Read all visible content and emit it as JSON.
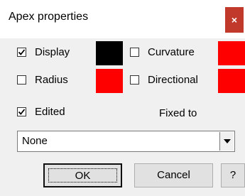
{
  "window": {
    "title": "Apex properties",
    "close_label": "×"
  },
  "options": {
    "display": {
      "label": "Display",
      "checked": true,
      "color": "#000000"
    },
    "curvature": {
      "label": "Curvature",
      "checked": false,
      "color": "#ff0000"
    },
    "radius": {
      "label": "Radius",
      "checked": false,
      "color": "#ff0000"
    },
    "directional": {
      "label": "Directional",
      "checked": false,
      "color": "#ff0000"
    },
    "edited": {
      "label": "Edited",
      "checked": true
    }
  },
  "fixed_to": {
    "label": "Fixed to",
    "value": "None"
  },
  "buttons": {
    "ok": "OK",
    "cancel": "Cancel",
    "help": "?"
  },
  "colors": {
    "title_bg": "#ffffff",
    "dialog_bg": "#f0f0f0",
    "close_bg": "#c0392b"
  }
}
